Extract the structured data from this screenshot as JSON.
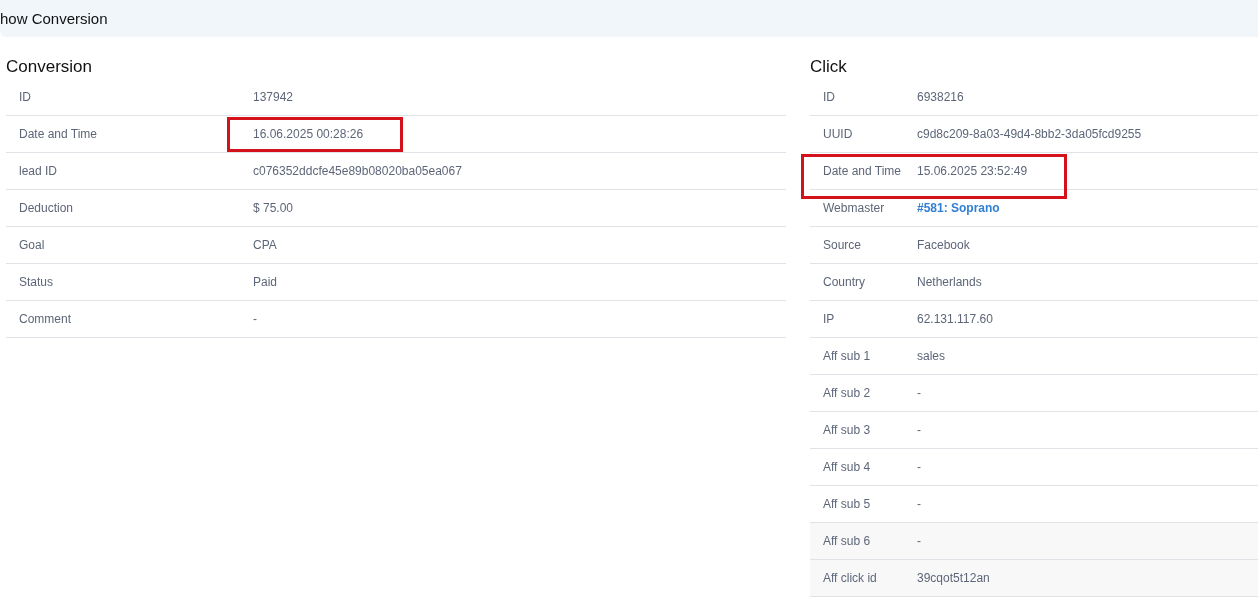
{
  "header": {
    "title": "how Conversion"
  },
  "panels": [
    {
      "title": "Conversion",
      "rows": [
        {
          "label": "ID",
          "value": "137942"
        },
        {
          "label": "Date and Time",
          "value": "16.06.2025 00:28:26",
          "marked": true
        },
        {
          "label": "lead ID",
          "value": "c076352ddcfe45e89b08020ba05ea067"
        },
        {
          "label": "Deduction",
          "value": "$ 75.00"
        },
        {
          "label": "Goal",
          "value": "CPA"
        },
        {
          "label": "Status",
          "value": "Paid"
        },
        {
          "label": "Comment",
          "value": "-"
        }
      ]
    },
    {
      "title": "Click",
      "rows": [
        {
          "label": "ID",
          "value": "6938216"
        },
        {
          "label": "UUID",
          "value": "c9d8c209-8a03-49d4-8bb2-3da05fcd9255"
        },
        {
          "label": "Date and Time",
          "value": "15.06.2025 23:52:49",
          "marked": true
        },
        {
          "label": "Webmaster",
          "value": "#581: Soprano",
          "kind": "link"
        },
        {
          "label": "Source",
          "value": "Facebook"
        },
        {
          "label": "Country",
          "value": "Netherlands"
        },
        {
          "label": "IP",
          "value": "62.131.117.60"
        },
        {
          "label": "Aff sub 1",
          "value": "sales"
        },
        {
          "label": "Aff sub 2",
          "value": "-"
        },
        {
          "label": "Aff sub 3",
          "value": "-"
        },
        {
          "label": "Aff sub 4",
          "value": "-"
        },
        {
          "label": "Aff sub 5",
          "value": "-"
        },
        {
          "label": "Aff sub 6",
          "value": "-",
          "shaded": true
        },
        {
          "label": "Aff click id",
          "value": "39cqot5t12an",
          "shaded": true
        }
      ]
    }
  ]
}
